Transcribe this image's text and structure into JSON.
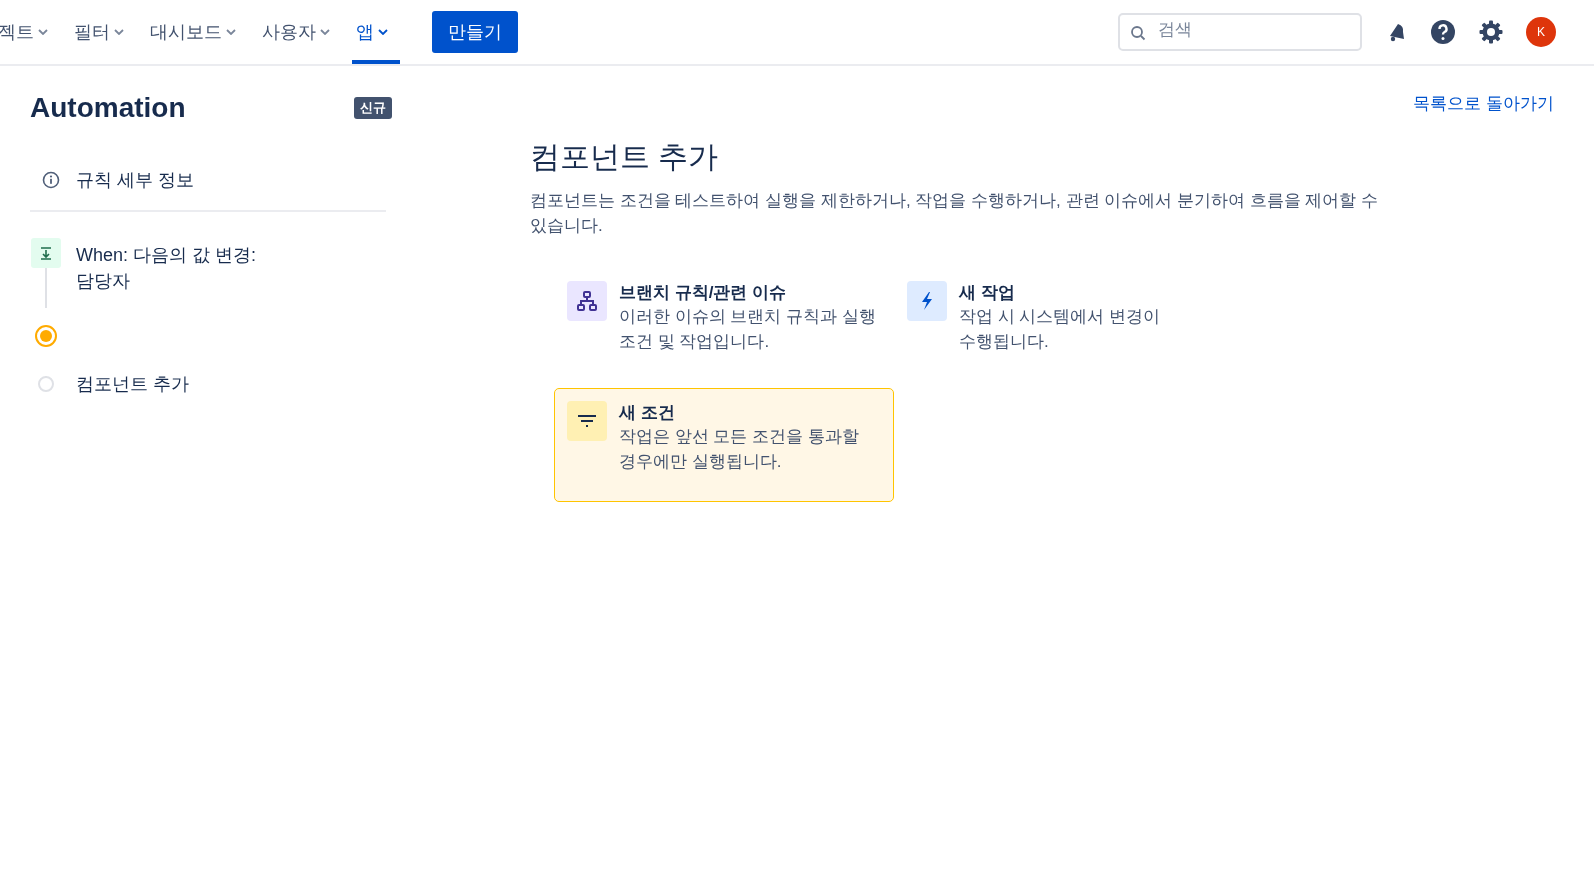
{
  "nav": {
    "items": [
      {
        "label": "젝트",
        "selected": false
      },
      {
        "label": "필터",
        "selected": false
      },
      {
        "label": "대시보드",
        "selected": false
      },
      {
        "label": "사용자",
        "selected": false
      },
      {
        "label": "앱",
        "selected": true
      }
    ],
    "create_button": "만들기",
    "search": {
      "placeholder": "검색"
    },
    "avatar": "K"
  },
  "sidebar": {
    "title": "Automation",
    "badge": "신규",
    "details": "규칙 세부 정보",
    "steps": [
      {
        "kind": "trigger",
        "label": "When: 다음의 값 변경: 담당자"
      },
      {
        "kind": "current"
      },
      {
        "kind": "pending",
        "label": "컴포넌트 추가"
      }
    ]
  },
  "main": {
    "back_link": "목록으로 돌아가기",
    "title": "컴포넌트 추가",
    "description": "컴포넌트는 조건을 테스트하여 실행을 제한하거나, 작업을 수행하거나, 관련 이슈에서 분기하여 흐름을 제어할 수 있습니다.",
    "options": [
      {
        "kind": "branch",
        "title": "브랜치 규칙/관련 이슈",
        "description": "이러한 이슈의 브랜치 규칙과 실행 조건 및 작업입니다.",
        "selected": false
      },
      {
        "kind": "action",
        "title": "새 작업",
        "description": "작업 시 시스템에서 변경이 수행됩니다.",
        "selected": false
      },
      {
        "kind": "condition",
        "title": "새 조건",
        "description": "작업은 앞선 모든 조건을 통과할 경우에만 실행됩니다.",
        "selected": true
      }
    ]
  }
}
